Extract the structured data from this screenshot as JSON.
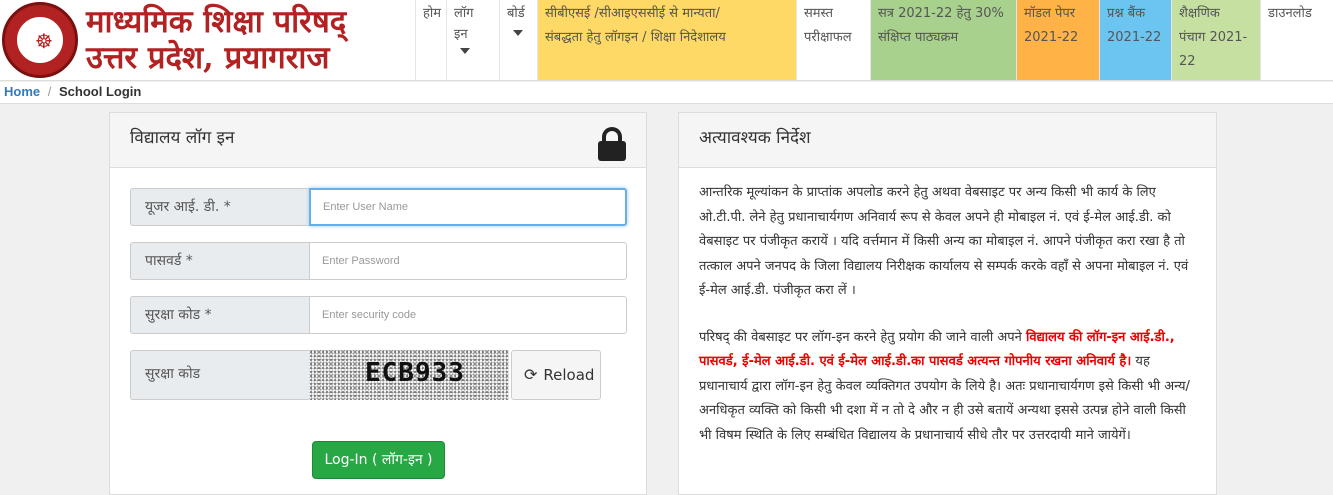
{
  "brand": {
    "line1": "माध्यमिक शिक्षा परिषद्",
    "line2": "उत्तर प्रदेश, प्रयागराज"
  },
  "nav": {
    "home": "होम",
    "login_line1": "लॉग",
    "login_line2": "इन",
    "board": "बोर्ड",
    "cbse_line1": "सीबीएसई /सीआइएससीई से मान्यता/",
    "cbse_line2": "संबद्धता हेतु लॉगइन / शिक्षा निदेशालय",
    "results_line1": "समस्त",
    "results_line2": "परीक्षाफल",
    "syllabus_line1": "सत्र 2021-22 हेतु 30%",
    "syllabus_line2": "संक्षिप्त पाठ्यक्रम",
    "model_line1": "मॉडल पेपर",
    "model_line2": "2021-22",
    "bank_line1": "प्रश्न बैंक",
    "bank_line2": "2021-22",
    "calendar_line1": "शैक्षणिक",
    "calendar_line2": "पंचाग 2021-",
    "calendar_line3": "22",
    "download": "डाउनलोड"
  },
  "breadcrumb": {
    "home": "Home",
    "separator": "/",
    "current": "School Login"
  },
  "login": {
    "title": "विद्यालय लॉग इन",
    "user_label": "यूजर आई. डी. *",
    "user_placeholder": "Enter User Name",
    "password_label": "पासवर्ड *",
    "password_placeholder": "Enter Password",
    "security_label": "सुरक्षा कोड *",
    "security_placeholder": "Enter security code",
    "captcha_label": "सुरक्षा कोड",
    "captcha_value": "ECB933",
    "reload_label": "Reload",
    "submit_label": "Log-In ( लॉग-इन )"
  },
  "info": {
    "title": "अत्यावश्यक निर्देश",
    "para1": "आन्तरिक मूल्यांकन के प्राप्तांक अपलोड करने हेतु अथवा वेबसाइट पर अन्य किसी भी कार्य के लिए ओ.टी.पी. लेने हेतु प्रधानाचार्यगण अनिवार्य रूप से केवल अपने ही मोबाइल नं. एवं ई-मेल आई.डी. को वेबसाइट पर पंजीकृत करायें । यदि वर्त्तमान में किसी अन्य का मोबाइल नं. आपने पंजीकृत करा रखा है तो तत्काल अपने जनपद के जिला विद्यालय निरीक्षक कार्यालय से सम्पर्क करके वहाँ से अपना मोबाइल नं. एवं ई-मेल आई.डी. पंजीकृत करा लें ।",
    "para2_prefix": "परिषद् की वेबसाइट पर लॉग-इन करने हेतु प्रयोग की जाने वाली अपने ",
    "para2_red": "विद्यालय की लॉग-इन आई.डी., पासवर्ड, ई-मेल आई.डी. एवं ई-मेल आई.डी.का पासवर्ड अत्यन्त गोपनीय रखना अनिवार्य है।",
    "para2_suffix": " यह प्रधानाचार्य द्वारा लॉग-इन हेतु केवल व्यक्तिगत उपयोग के लिये है। अतः प्रधानाचार्यगण इसे किसी भी अन्य/अनधिकृत व्यक्ति को किसी भी दशा में न तो दे और न ही उसे बतायें अन्यथा इससे उत्पन्न होने वाली किसी भी विषम स्थिति के लिए सम्बंधित विद्यालय के प्रधानाचार्य सीधे तौर पर उत्तरदायी माने जायेगें।"
  },
  "colors": {
    "brand_red": "#b22222",
    "nav_yellow": "#ffd966",
    "nav_green": "#a9d18e",
    "nav_orange": "#ffb347",
    "nav_blue": "#6cc5f0",
    "login_green": "#28a745",
    "warning_red": "#e00000"
  }
}
